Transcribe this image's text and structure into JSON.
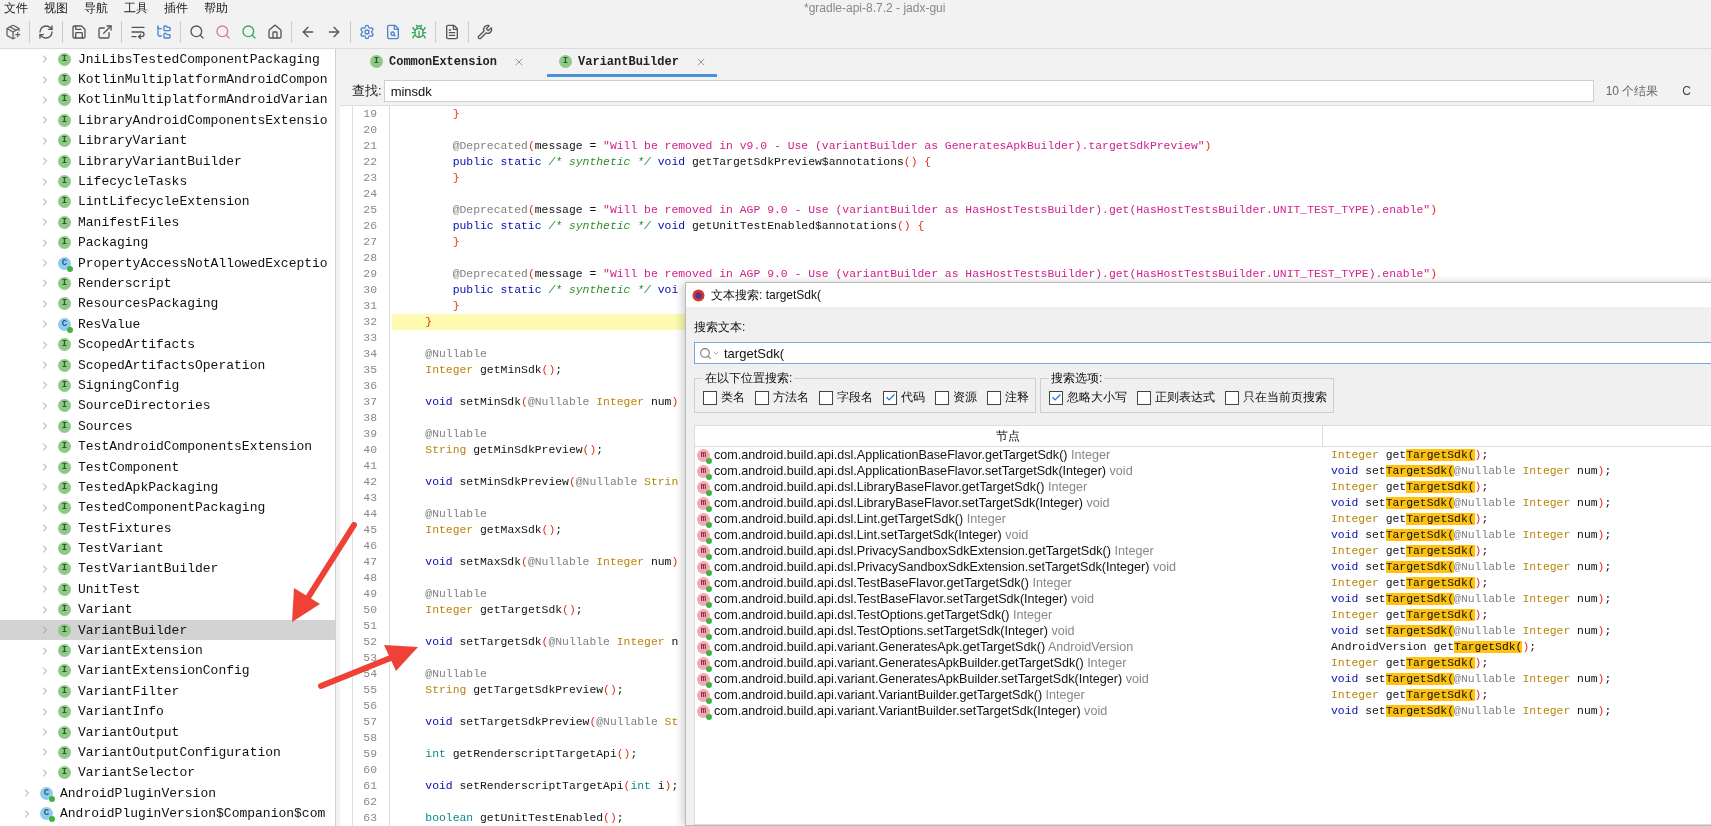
{
  "menu": [
    "文件",
    "视图",
    "导航",
    "工具",
    "插件",
    "帮助"
  ],
  "window_title": "*gradle-api-8.7.2 - jadx-gui",
  "tree": [
    {
      "children": [
        {
          "label": "JniLibsTestedComponentPackaging",
          "kind": "interface",
          "badge": "I",
          "selected": false,
          "expanded": false
        },
        {
          "label": "KotlinMultiplatformAndroidCompon",
          "kind": "interface",
          "badge": "I",
          "selected": false,
          "expanded": false
        },
        {
          "label": "KotlinMultiplatformAndroidVarian",
          "kind": "interface",
          "badge": "I",
          "selected": false,
          "expanded": false
        },
        {
          "label": "LibraryAndroidComponentsExtensio",
          "kind": "interface",
          "badge": "I",
          "selected": false,
          "expanded": false
        },
        {
          "label": "LibraryVariant",
          "kind": "interface",
          "badge": "I",
          "selected": false,
          "expanded": false
        },
        {
          "label": "LibraryVariantBuilder",
          "kind": "interface",
          "badge": "I",
          "selected": false,
          "expanded": false
        },
        {
          "label": "LifecycleTasks",
          "kind": "interface",
          "badge": "I",
          "selected": false,
          "expanded": false
        },
        {
          "label": "LintLifecycleExtension",
          "kind": "interface",
          "badge": "I",
          "selected": false,
          "expanded": false
        },
        {
          "label": "ManifestFiles",
          "kind": "interface",
          "badge": "I",
          "selected": false,
          "expanded": false
        },
        {
          "label": "Packaging",
          "kind": "interface",
          "badge": "I",
          "selected": false,
          "expanded": false
        },
        {
          "label": "PropertyAccessNotAllowedExceptio",
          "kind": "class",
          "badge": "C",
          "selected": false,
          "expanded": false
        },
        {
          "label": "Renderscript",
          "kind": "interface",
          "badge": "I",
          "selected": false,
          "expanded": false
        },
        {
          "label": "ResourcesPackaging",
          "kind": "interface",
          "badge": "I",
          "selected": false,
          "expanded": false
        },
        {
          "label": "ResValue",
          "kind": "class",
          "badge": "C",
          "selected": false,
          "expanded": false
        },
        {
          "label": "ScopedArtifacts",
          "kind": "interface",
          "badge": "I",
          "selected": false,
          "expanded": false
        },
        {
          "label": "ScopedArtifactsOperation",
          "kind": "interface",
          "badge": "I",
          "selected": false,
          "expanded": false
        },
        {
          "label": "SigningConfig",
          "kind": "interface",
          "badge": "I",
          "selected": false,
          "expanded": false
        },
        {
          "label": "SourceDirectories",
          "kind": "interface",
          "badge": "I",
          "selected": false,
          "expanded": false
        },
        {
          "label": "Sources",
          "kind": "interface",
          "badge": "I",
          "selected": false,
          "expanded": false
        },
        {
          "label": "TestAndroidComponentsExtension",
          "kind": "interface",
          "badge": "I",
          "selected": false,
          "expanded": false
        },
        {
          "label": "TestComponent",
          "kind": "interface",
          "badge": "I",
          "selected": false,
          "expanded": false
        },
        {
          "label": "TestedApkPackaging",
          "kind": "interface",
          "badge": "I",
          "selected": false,
          "expanded": false
        },
        {
          "label": "TestedComponentPackaging",
          "kind": "interface",
          "badge": "I",
          "selected": false,
          "expanded": false
        },
        {
          "label": "TestFixtures",
          "kind": "interface",
          "badge": "I",
          "selected": false,
          "expanded": false
        },
        {
          "label": "TestVariant",
          "kind": "interface",
          "badge": "I",
          "selected": false,
          "expanded": false
        },
        {
          "label": "TestVariantBuilder",
          "kind": "interface",
          "badge": "I",
          "selected": false,
          "expanded": false
        },
        {
          "label": "UnitTest",
          "kind": "interface",
          "badge": "I",
          "selected": false,
          "expanded": false
        },
        {
          "label": "Variant",
          "kind": "interface",
          "badge": "I",
          "selected": false,
          "expanded": false
        },
        {
          "label": "VariantBuilder",
          "kind": "interface",
          "badge": "I",
          "selected": true,
          "expanded": false
        },
        {
          "label": "VariantExtension",
          "kind": "interface",
          "badge": "I",
          "selected": false,
          "expanded": false
        },
        {
          "label": "VariantExtensionConfig",
          "kind": "interface",
          "badge": "I",
          "selected": false,
          "expanded": false
        },
        {
          "label": "VariantFilter",
          "kind": "interface",
          "badge": "I",
          "selected": false,
          "expanded": false
        },
        {
          "label": "VariantInfo",
          "kind": "interface",
          "badge": "I",
          "selected": false,
          "expanded": false
        },
        {
          "label": "VariantOutput",
          "kind": "interface",
          "badge": "I",
          "selected": false,
          "expanded": false
        },
        {
          "label": "VariantOutputConfiguration",
          "kind": "interface",
          "badge": "I",
          "selected": false,
          "expanded": false
        },
        {
          "label": "VariantSelector",
          "kind": "interface",
          "badge": "I",
          "selected": false,
          "expanded": false
        }
      ]
    },
    {
      "label": "AndroidPluginVersion",
      "kind": "class",
      "badge": "C",
      "selected": false,
      "expanded": false
    },
    {
      "label": "AndroidPluginVersion$Companion$com",
      "kind": "class",
      "badge": "C",
      "selected": false,
      "expanded": false
    }
  ],
  "tabs": [
    {
      "label": "CommonExtension",
      "badge": "I",
      "selected": false
    },
    {
      "label": "VariantBuilder",
      "badge": "I",
      "selected": true
    }
  ],
  "find_bar": {
    "label": "查找:",
    "value": "minsdk",
    "result_count": "10 个结果",
    "option": "C"
  },
  "code": {
    "lines": [
      {
        "no": "19",
        "highlighted": false,
        "tokens": [
          {
            "kind": "brace",
            "text": "        }"
          }
        ]
      },
      {
        "no": "20",
        "highlighted": false
      },
      {
        "no": "21",
        "highlighted": false,
        "tokens": [
          {
            "kind": "ann",
            "text": "        @Deprecated"
          },
          {
            "kind": "brace",
            "text": "("
          },
          {
            "kind": "plain",
            "text": "message = "
          },
          {
            "kind": "str",
            "text": "\"Will be removed in v9.0 - Use (variantBuilder as GeneratesApkBuilder).targetSdkPreview\""
          },
          {
            "kind": "brace",
            "text": ")"
          }
        ]
      },
      {
        "no": "22",
        "highlighted": false,
        "tokens": [
          {
            "kind": "kw",
            "text": "        public static "
          },
          {
            "kind": "cm",
            "text": "/* synthetic */ "
          },
          {
            "kind": "kw",
            "text": "void"
          },
          {
            "kind": "plain",
            "text": " getTargetSdkPreview$annotations"
          },
          {
            "kind": "brace",
            "text": "() {"
          }
        ]
      },
      {
        "no": "23",
        "highlighted": false,
        "tokens": [
          {
            "kind": "brace",
            "text": "        }"
          }
        ]
      },
      {
        "no": "24",
        "highlighted": false
      },
      {
        "no": "25",
        "highlighted": false,
        "tokens": [
          {
            "kind": "ann",
            "text": "        @Deprecated"
          },
          {
            "kind": "brace",
            "text": "("
          },
          {
            "kind": "plain",
            "text": "message = "
          },
          {
            "kind": "str",
            "text": "\"Will be removed in AGP 9.0 - Use (variantBuilder as HasHostTestsBuilder).get(HasHostTestsBuilder.UNIT_TEST_TYPE).enable\""
          },
          {
            "kind": "brace",
            "text": ")"
          }
        ]
      },
      {
        "no": "26",
        "highlighted": false,
        "tokens": [
          {
            "kind": "kw",
            "text": "        public static "
          },
          {
            "kind": "cm",
            "text": "/* synthetic */ "
          },
          {
            "kind": "kw",
            "text": "void"
          },
          {
            "kind": "plain",
            "text": " getUnitTestEnabled$annotations"
          },
          {
            "kind": "brace",
            "text": "() {"
          }
        ]
      },
      {
        "no": "27",
        "highlighted": false,
        "tokens": [
          {
            "kind": "brace",
            "text": "        }"
          }
        ]
      },
      {
        "no": "28",
        "highlighted": false
      },
      {
        "no": "29",
        "highlighted": false,
        "tokens": [
          {
            "kind": "ann",
            "text": "        @Deprecated"
          },
          {
            "kind": "brace",
            "text": "("
          },
          {
            "kind": "plain",
            "text": "message = "
          },
          {
            "kind": "str",
            "text": "\"Will be removed in AGP 9.0 - Use (variantBuilder as HasHostTestsBuilder).get(HasHostTestsBuilder.UNIT_TEST_TYPE).enable\""
          },
          {
            "kind": "brace",
            "text": ")"
          }
        ]
      },
      {
        "no": "30",
        "highlighted": false,
        "tokens": [
          {
            "kind": "kw",
            "text": "        public static "
          },
          {
            "kind": "cm",
            "text": "/* synthetic */ "
          },
          {
            "kind": "kw",
            "text": "voi"
          }
        ]
      },
      {
        "no": "31",
        "highlighted": false,
        "tokens": [
          {
            "kind": "brace",
            "text": "        }"
          }
        ]
      },
      {
        "no": "32",
        "highlighted": true,
        "tokens": [
          {
            "kind": "brace",
            "text": "    }"
          }
        ]
      },
      {
        "no": "33",
        "highlighted": false
      },
      {
        "no": "34",
        "highlighted": false,
        "tokens": [
          {
            "kind": "ann",
            "text": "    @Nullable"
          }
        ]
      },
      {
        "no": "35",
        "highlighted": false,
        "tokens": [
          {
            "kind": "type",
            "text": "    Integer"
          },
          {
            "kind": "plain",
            "text": " getMinSdk"
          },
          {
            "kind": "brace",
            "text": "()"
          },
          {
            "kind": "plain",
            "text": ";"
          }
        ]
      },
      {
        "no": "36",
        "highlighted": false
      },
      {
        "no": "37",
        "highlighted": false,
        "tokens": [
          {
            "kind": "kw",
            "text": "    void"
          },
          {
            "kind": "plain",
            "text": " setMinSdk"
          },
          {
            "kind": "brace",
            "text": "("
          },
          {
            "kind": "ann",
            "text": "@Nullable "
          },
          {
            "kind": "type",
            "text": "Integer"
          },
          {
            "kind": "plain",
            "text": " num"
          },
          {
            "kind": "brace",
            "text": ")"
          }
        ]
      },
      {
        "no": "38",
        "highlighted": false
      },
      {
        "no": "39",
        "highlighted": false,
        "tokens": [
          {
            "kind": "ann",
            "text": "    @Nullable"
          }
        ]
      },
      {
        "no": "40",
        "highlighted": false,
        "tokens": [
          {
            "kind": "type",
            "text": "    String"
          },
          {
            "kind": "plain",
            "text": " getMinSdkPreview"
          },
          {
            "kind": "brace",
            "text": "()"
          },
          {
            "kind": "plain",
            "text": ";"
          }
        ]
      },
      {
        "no": "41",
        "highlighted": false
      },
      {
        "no": "42",
        "highlighted": false,
        "tokens": [
          {
            "kind": "kw",
            "text": "    void"
          },
          {
            "kind": "plain",
            "text": " setMinSdkPreview"
          },
          {
            "kind": "brace",
            "text": "("
          },
          {
            "kind": "ann",
            "text": "@Nullable "
          },
          {
            "kind": "type",
            "text": "Strin"
          }
        ]
      },
      {
        "no": "43",
        "highlighted": false
      },
      {
        "no": "44",
        "highlighted": false,
        "tokens": [
          {
            "kind": "ann",
            "text": "    @Nullable"
          }
        ]
      },
      {
        "no": "45",
        "highlighted": false,
        "tokens": [
          {
            "kind": "type",
            "text": "    Integer"
          },
          {
            "kind": "plain",
            "text": " getMaxSdk"
          },
          {
            "kind": "brace",
            "text": "()"
          },
          {
            "kind": "plain",
            "text": ";"
          }
        ]
      },
      {
        "no": "46",
        "highlighted": false
      },
      {
        "no": "47",
        "highlighted": false,
        "tokens": [
          {
            "kind": "kw",
            "text": "    void"
          },
          {
            "kind": "plain",
            "text": " setMaxSdk"
          },
          {
            "kind": "brace",
            "text": "("
          },
          {
            "kind": "ann",
            "text": "@Nullable "
          },
          {
            "kind": "type",
            "text": "Integer"
          },
          {
            "kind": "plain",
            "text": " num"
          },
          {
            "kind": "brace",
            "text": ")"
          }
        ]
      },
      {
        "no": "48",
        "highlighted": false
      },
      {
        "no": "49",
        "highlighted": false,
        "tokens": [
          {
            "kind": "ann",
            "text": "    @Nullable"
          }
        ]
      },
      {
        "no": "50",
        "highlighted": false,
        "tokens": [
          {
            "kind": "type",
            "text": "    Integer"
          },
          {
            "kind": "plain",
            "text": " getTargetSdk"
          },
          {
            "kind": "brace",
            "text": "()"
          },
          {
            "kind": "plain",
            "text": ";"
          }
        ]
      },
      {
        "no": "51",
        "highlighted": false
      },
      {
        "no": "52",
        "highlighted": false,
        "tokens": [
          {
            "kind": "kw",
            "text": "    void"
          },
          {
            "kind": "plain",
            "text": " setTargetSdk"
          },
          {
            "kind": "brace",
            "text": "("
          },
          {
            "kind": "ann",
            "text": "@Nullable "
          },
          {
            "kind": "type",
            "text": "Integer"
          },
          {
            "kind": "plain",
            "text": " n"
          }
        ]
      },
      {
        "no": "53",
        "highlighted": false
      },
      {
        "no": "54",
        "highlighted": false,
        "tokens": [
          {
            "kind": "ann",
            "text": "    @Nullable"
          }
        ]
      },
      {
        "no": "55",
        "highlighted": false,
        "tokens": [
          {
            "kind": "type",
            "text": "    String"
          },
          {
            "kind": "plain",
            "text": " getTargetSdkPreview"
          },
          {
            "kind": "brace",
            "text": "()"
          },
          {
            "kind": "plain",
            "text": ";"
          }
        ]
      },
      {
        "no": "56",
        "highlighted": false
      },
      {
        "no": "57",
        "highlighted": false,
        "tokens": [
          {
            "kind": "kw",
            "text": "    void"
          },
          {
            "kind": "plain",
            "text": " setTargetSdkPreview"
          },
          {
            "kind": "brace",
            "text": "("
          },
          {
            "kind": "ann",
            "text": "@Nullable "
          },
          {
            "kind": "type",
            "text": "St"
          }
        ]
      },
      {
        "no": "58",
        "highlighted": false
      },
      {
        "no": "59",
        "highlighted": false,
        "tokens": [
          {
            "kind": "prim",
            "text": "    int"
          },
          {
            "kind": "plain",
            "text": " getRenderscriptTargetApi"
          },
          {
            "kind": "brace",
            "text": "()"
          },
          {
            "kind": "plain",
            "text": ";"
          }
        ]
      },
      {
        "no": "60",
        "highlighted": false
      },
      {
        "no": "61",
        "highlighted": false,
        "tokens": [
          {
            "kind": "kw",
            "text": "    void"
          },
          {
            "kind": "plain",
            "text": " setRenderscriptTargetApi"
          },
          {
            "kind": "brace",
            "text": "("
          },
          {
            "kind": "prim",
            "text": "int"
          },
          {
            "kind": "plain",
            "text": " i"
          },
          {
            "kind": "brace",
            "text": ")"
          },
          {
            "kind": "plain",
            "text": ";"
          }
        ]
      },
      {
        "no": "62",
        "highlighted": false
      },
      {
        "no": "63",
        "highlighted": false,
        "tokens": [
          {
            "kind": "prim",
            "text": "    boolean"
          },
          {
            "kind": "plain",
            "text": " getUnitTestEnabled"
          },
          {
            "kind": "brace",
            "text": "()"
          },
          {
            "kind": "plain",
            "text": ";"
          }
        ]
      }
    ]
  },
  "dialog": {
    "title": "文本搜索: targetSdk(",
    "search_label": "搜索文本:",
    "query": "targetSdk(",
    "groups": [
      {
        "title": "在以下位置搜索:",
        "options": [
          {
            "label": "类名",
            "checked": false
          },
          {
            "label": "方法名",
            "checked": false
          },
          {
            "label": "字段名",
            "checked": false
          },
          {
            "label": "代码",
            "checked": true
          },
          {
            "label": "资源",
            "checked": false
          },
          {
            "label": "注释",
            "checked": false
          }
        ]
      },
      {
        "title": "搜索选项:",
        "options": [
          {
            "label": "忽略大小写",
            "checked": true
          },
          {
            "label": "正则表达式",
            "checked": false
          },
          {
            "label": "只在当前页搜索",
            "checked": false
          }
        ]
      }
    ],
    "table": {
      "columns": [
        "节点"
      ],
      "rows": [
        {
          "badge": "m",
          "node": "com.android.build.api.dsl.ApplicationBaseFlavor.getTargetSdk()",
          "type": "Integer",
          "code": [
            {
              "kind": "type",
              "text": "Integer"
            },
            {
              "kind": "plain",
              "text": " get"
            },
            {
              "kind": "match",
              "text": "TargetSdk("
            },
            {
              "kind": "brace",
              "text": ")"
            },
            {
              "kind": "plain",
              "text": ";"
            }
          ]
        },
        {
          "badge": "m",
          "node": "com.android.build.api.dsl.ApplicationBaseFlavor.setTargetSdk(Integer)",
          "type": "void",
          "code": [
            {
              "kind": "kw",
              "text": "void"
            },
            {
              "kind": "plain",
              "text": " set"
            },
            {
              "kind": "match",
              "text": "TargetSdk("
            },
            {
              "kind": "ann",
              "text": "@Nullable "
            },
            {
              "kind": "type",
              "text": "Integer"
            },
            {
              "kind": "plain",
              "text": " num"
            },
            {
              "kind": "brace",
              "text": ")"
            },
            {
              "kind": "plain",
              "text": ";"
            }
          ]
        },
        {
          "badge": "m",
          "node": "com.android.build.api.dsl.LibraryBaseFlavor.getTargetSdk()",
          "type": "Integer",
          "code": [
            {
              "kind": "type",
              "text": "Integer"
            },
            {
              "kind": "plain",
              "text": " get"
            },
            {
              "kind": "match",
              "text": "TargetSdk("
            },
            {
              "kind": "brace",
              "text": ")"
            },
            {
              "kind": "plain",
              "text": ";"
            }
          ]
        },
        {
          "badge": "m",
          "node": "com.android.build.api.dsl.LibraryBaseFlavor.setTargetSdk(Integer)",
          "type": "void",
          "code": [
            {
              "kind": "kw",
              "text": "void"
            },
            {
              "kind": "plain",
              "text": " set"
            },
            {
              "kind": "match",
              "text": "TargetSdk("
            },
            {
              "kind": "ann",
              "text": "@Nullable "
            },
            {
              "kind": "type",
              "text": "Integer"
            },
            {
              "kind": "plain",
              "text": " num"
            },
            {
              "kind": "brace",
              "text": ")"
            },
            {
              "kind": "plain",
              "text": ";"
            }
          ]
        },
        {
          "badge": "m",
          "node": "com.android.build.api.dsl.Lint.getTargetSdk()",
          "type": "Integer",
          "code": [
            {
              "kind": "type",
              "text": "Integer"
            },
            {
              "kind": "plain",
              "text": " get"
            },
            {
              "kind": "match",
              "text": "TargetSdk("
            },
            {
              "kind": "brace",
              "text": ")"
            },
            {
              "kind": "plain",
              "text": ";"
            }
          ]
        },
        {
          "badge": "m",
          "node": "com.android.build.api.dsl.Lint.setTargetSdk(Integer)",
          "type": "void",
          "code": [
            {
              "kind": "kw",
              "text": "void"
            },
            {
              "kind": "plain",
              "text": " set"
            },
            {
              "kind": "match",
              "text": "TargetSdk("
            },
            {
              "kind": "ann",
              "text": "@Nullable "
            },
            {
              "kind": "type",
              "text": "Integer"
            },
            {
              "kind": "plain",
              "text": " num"
            },
            {
              "kind": "brace",
              "text": ")"
            },
            {
              "kind": "plain",
              "text": ";"
            }
          ]
        },
        {
          "badge": "m",
          "node": "com.android.build.api.dsl.PrivacySandboxSdkExtension.getTargetSdk()",
          "type": "Integer",
          "code": [
            {
              "kind": "type",
              "text": "Integer"
            },
            {
              "kind": "plain",
              "text": " get"
            },
            {
              "kind": "match",
              "text": "TargetSdk("
            },
            {
              "kind": "brace",
              "text": ")"
            },
            {
              "kind": "plain",
              "text": ";"
            }
          ]
        },
        {
          "badge": "m",
          "node": "com.android.build.api.dsl.PrivacySandboxSdkExtension.setTargetSdk(Integer)",
          "type": "void",
          "code": [
            {
              "kind": "kw",
              "text": "void"
            },
            {
              "kind": "plain",
              "text": " set"
            },
            {
              "kind": "match",
              "text": "TargetSdk("
            },
            {
              "kind": "ann",
              "text": "@Nullable "
            },
            {
              "kind": "type",
              "text": "Integer"
            },
            {
              "kind": "plain",
              "text": " num"
            },
            {
              "kind": "brace",
              "text": ")"
            },
            {
              "kind": "plain",
              "text": ";"
            }
          ]
        },
        {
          "badge": "m",
          "node": "com.android.build.api.dsl.TestBaseFlavor.getTargetSdk()",
          "type": "Integer",
          "code": [
            {
              "kind": "type",
              "text": "Integer"
            },
            {
              "kind": "plain",
              "text": " get"
            },
            {
              "kind": "match",
              "text": "TargetSdk("
            },
            {
              "kind": "brace",
              "text": ")"
            },
            {
              "kind": "plain",
              "text": ";"
            }
          ]
        },
        {
          "badge": "m",
          "node": "com.android.build.api.dsl.TestBaseFlavor.setTargetSdk(Integer)",
          "type": "void",
          "code": [
            {
              "kind": "kw",
              "text": "void"
            },
            {
              "kind": "plain",
              "text": " set"
            },
            {
              "kind": "match",
              "text": "TargetSdk("
            },
            {
              "kind": "ann",
              "text": "@Nullable "
            },
            {
              "kind": "type",
              "text": "Integer"
            },
            {
              "kind": "plain",
              "text": " num"
            },
            {
              "kind": "brace",
              "text": ")"
            },
            {
              "kind": "plain",
              "text": ";"
            }
          ]
        },
        {
          "badge": "m",
          "node": "com.android.build.api.dsl.TestOptions.getTargetSdk()",
          "type": "Integer",
          "code": [
            {
              "kind": "type",
              "text": "Integer"
            },
            {
              "kind": "plain",
              "text": " get"
            },
            {
              "kind": "match",
              "text": "TargetSdk("
            },
            {
              "kind": "brace",
              "text": ")"
            },
            {
              "kind": "plain",
              "text": ";"
            }
          ]
        },
        {
          "badge": "m",
          "node": "com.android.build.api.dsl.TestOptions.setTargetSdk(Integer)",
          "type": "void",
          "code": [
            {
              "kind": "kw",
              "text": "void"
            },
            {
              "kind": "plain",
              "text": " set"
            },
            {
              "kind": "match",
              "text": "TargetSdk("
            },
            {
              "kind": "ann",
              "text": "@Nullable "
            },
            {
              "kind": "type",
              "text": "Integer"
            },
            {
              "kind": "plain",
              "text": " num"
            },
            {
              "kind": "brace",
              "text": ")"
            },
            {
              "kind": "plain",
              "text": ";"
            }
          ]
        },
        {
          "badge": "m",
          "node": "com.android.build.api.variant.GeneratesApk.getTargetSdk()",
          "type": "AndroidVersion",
          "code": [
            {
              "kind": "plain",
              "text": "AndroidVersion get"
            },
            {
              "kind": "match",
              "text": "TargetSdk("
            },
            {
              "kind": "brace",
              "text": ")"
            },
            {
              "kind": "plain",
              "text": ";"
            }
          ]
        },
        {
          "badge": "m",
          "node": "com.android.build.api.variant.GeneratesApkBuilder.getTargetSdk()",
          "type": "Integer",
          "code": [
            {
              "kind": "type",
              "text": "Integer"
            },
            {
              "kind": "plain",
              "text": " get"
            },
            {
              "kind": "match",
              "text": "TargetSdk("
            },
            {
              "kind": "brace",
              "text": ")"
            },
            {
              "kind": "plain",
              "text": ";"
            }
          ]
        },
        {
          "badge": "m",
          "node": "com.android.build.api.variant.GeneratesApkBuilder.setTargetSdk(Integer)",
          "type": "void",
          "code": [
            {
              "kind": "kw",
              "text": "void"
            },
            {
              "kind": "plain",
              "text": " set"
            },
            {
              "kind": "match",
              "text": "TargetSdk("
            },
            {
              "kind": "ann",
              "text": "@Nullable "
            },
            {
              "kind": "type",
              "text": "Integer"
            },
            {
              "kind": "plain",
              "text": " num"
            },
            {
              "kind": "brace",
              "text": ")"
            },
            {
              "kind": "plain",
              "text": ";"
            }
          ]
        },
        {
          "badge": "m",
          "node": "com.android.build.api.variant.VariantBuilder.getTargetSdk()",
          "type": "Integer",
          "code": [
            {
              "kind": "type",
              "text": "Integer"
            },
            {
              "kind": "plain",
              "text": " get"
            },
            {
              "kind": "match",
              "text": "TargetSdk("
            },
            {
              "kind": "brace",
              "text": ")"
            },
            {
              "kind": "plain",
              "text": ";"
            }
          ]
        },
        {
          "badge": "m",
          "node": "com.android.build.api.variant.VariantBuilder.setTargetSdk(Integer)",
          "type": "void",
          "code": [
            {
              "kind": "kw",
              "text": "void"
            },
            {
              "kind": "plain",
              "text": " set"
            },
            {
              "kind": "match",
              "text": "TargetSdk("
            },
            {
              "kind": "ann",
              "text": "@Nullable "
            },
            {
              "kind": "type",
              "text": "Integer"
            },
            {
              "kind": "plain",
              "text": " num"
            },
            {
              "kind": "brace",
              "text": ")"
            },
            {
              "kind": "plain",
              "text": ";"
            }
          ]
        }
      ]
    }
  }
}
